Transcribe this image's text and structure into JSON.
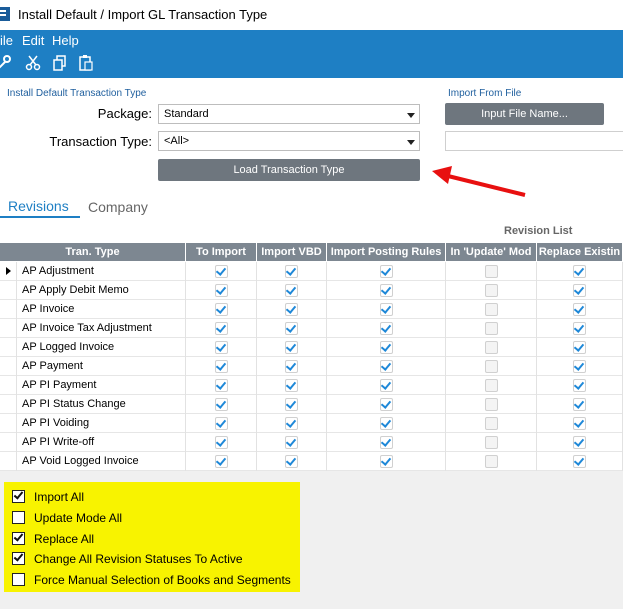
{
  "window": {
    "title": "Install Default / Import GL Transaction Type"
  },
  "menu": {
    "items": [
      "ile",
      "Edit",
      "Help"
    ]
  },
  "toolbar": {
    "icons": [
      "wrench-icon",
      "scissors-icon",
      "copy-icon",
      "paste-icon"
    ]
  },
  "install_group": {
    "label": "Install Default Transaction Type",
    "package_label": "Package:",
    "package_value": "Standard",
    "trantype_label": "Transaction Type:",
    "trantype_value": "<All>",
    "load_button": "Load Transaction Type"
  },
  "import_group": {
    "label": "Import From File",
    "input_button": "Input File Name...",
    "file_value": ""
  },
  "tabs": [
    "Revisions",
    "Company"
  ],
  "grid": {
    "group_header": "Revision List",
    "columns": [
      "Tran. Type",
      "To Import",
      "Import VBD",
      "Import Posting Rules",
      "In 'Update' Mod",
      "Replace Existin"
    ],
    "rows": [
      {
        "name": "AP Adjustment",
        "to_import": true,
        "vbd": true,
        "posting": true,
        "update": false,
        "replace": true
      },
      {
        "name": "AP Apply Debit Memo",
        "to_import": true,
        "vbd": true,
        "posting": true,
        "update": false,
        "replace": true
      },
      {
        "name": "AP Invoice",
        "to_import": true,
        "vbd": true,
        "posting": true,
        "update": false,
        "replace": true
      },
      {
        "name": "AP Invoice Tax Adjustment",
        "to_import": true,
        "vbd": true,
        "posting": true,
        "update": false,
        "replace": true
      },
      {
        "name": "AP Logged Invoice",
        "to_import": true,
        "vbd": true,
        "posting": true,
        "update": false,
        "replace": true
      },
      {
        "name": "AP Payment",
        "to_import": true,
        "vbd": true,
        "posting": true,
        "update": false,
        "replace": true
      },
      {
        "name": "AP PI Payment",
        "to_import": true,
        "vbd": true,
        "posting": true,
        "update": false,
        "replace": true
      },
      {
        "name": "AP PI Status Change",
        "to_import": true,
        "vbd": true,
        "posting": true,
        "update": false,
        "replace": true
      },
      {
        "name": "AP PI Voiding",
        "to_import": true,
        "vbd": true,
        "posting": true,
        "update": false,
        "replace": true
      },
      {
        "name": "AP PI Write-off",
        "to_import": true,
        "vbd": true,
        "posting": true,
        "update": false,
        "replace": true
      },
      {
        "name": "AP Void Logged Invoice",
        "to_import": true,
        "vbd": true,
        "posting": true,
        "update": false,
        "replace": true
      }
    ]
  },
  "options": [
    {
      "label": "Import All",
      "checked": true
    },
    {
      "label": "Update Mode All",
      "checked": false
    },
    {
      "label": "Replace All",
      "checked": true
    },
    {
      "label": "Change All Revision Statuses To Active",
      "checked": true
    },
    {
      "label": "Force Manual Selection of Books and Segments",
      "checked": false
    }
  ],
  "colors": {
    "accent": "#1e7fc4",
    "highlight": "#f8f300",
    "annotation_arrow": "#e81010"
  }
}
